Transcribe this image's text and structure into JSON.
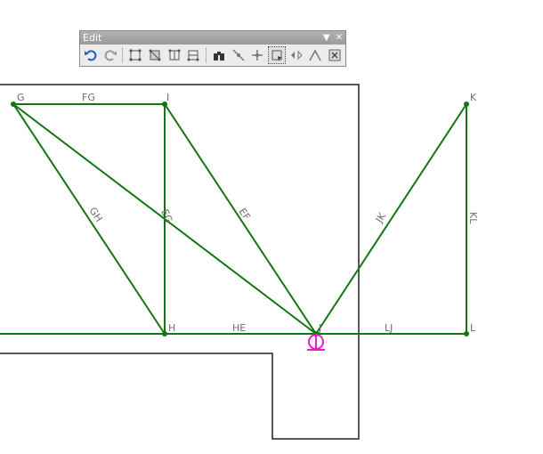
{
  "toolbar": {
    "title": "Edit",
    "dropdown_glyph": "▼",
    "close_glyph": "✕",
    "buttons": [
      {
        "icon": "undo-icon"
      },
      {
        "icon": "redo-icon"
      },
      {
        "icon": "select-node-icon"
      },
      {
        "icon": "select-element-icon"
      },
      {
        "icon": "select-support-icon"
      },
      {
        "icon": "select-load-icon"
      },
      {
        "icon": "find-icon"
      },
      {
        "icon": "split-member-icon"
      },
      {
        "icon": "join-members-icon"
      },
      {
        "icon": "move-node-icon"
      },
      {
        "icon": "mirror-icon"
      },
      {
        "icon": "copy-icon"
      },
      {
        "icon": "transform-icon"
      }
    ]
  },
  "model": {
    "member_color": "#117711",
    "support_color": "#e020d0",
    "outline_color": "#222222",
    "nodes": [
      {
        "id": "G",
        "label": "G"
      },
      {
        "id": "I",
        "label": "I"
      },
      {
        "id": "K",
        "label": "K"
      },
      {
        "id": "H",
        "label": "H"
      },
      {
        "id": "J",
        "label": "J"
      },
      {
        "id": "L",
        "label": "L"
      }
    ],
    "members": [
      {
        "id": "FG",
        "label": "FG"
      },
      {
        "id": "GH",
        "label": "GH"
      },
      {
        "id": "EG",
        "label": "EG"
      },
      {
        "id": "EF",
        "label": "EF"
      },
      {
        "id": "JK",
        "label": "JK"
      },
      {
        "id": "KL",
        "label": "KL"
      },
      {
        "id": "HE",
        "label": "HE"
      },
      {
        "id": "LJ",
        "label": "LJ"
      }
    ]
  }
}
